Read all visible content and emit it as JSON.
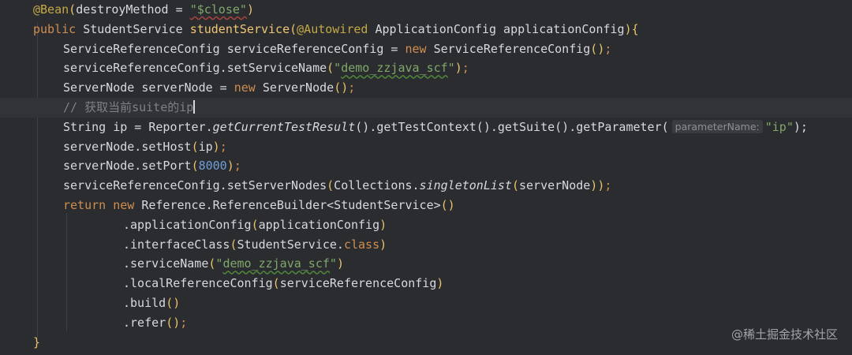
{
  "code": {
    "l1_annotation": "@Bean",
    "l1_paren_open": "(",
    "l1_attr": "destroyMethod",
    "l1_eq": " = ",
    "l1_string": "\"$close\"",
    "l1_paren_close": ")",
    "l2_public": "public",
    "l2_type": " StudentService ",
    "l2_method": "studentService",
    "l2_paren_open": "(",
    "l2_annotation": "@Autowired",
    "l2_params": " ApplicationConfig applicationConfig",
    "l2_paren_close": ")",
    "l2_brace": "{",
    "l3_a": "ServiceReferenceConfig serviceReferenceConfig = ",
    "l3_new": "new",
    "l3_b": " ServiceReferenceConfig",
    "l3_parens": "()",
    "l3_semi": ";",
    "l4_a": "serviceReferenceConfig.setServiceName",
    "l4_po": "(",
    "l4_q1": "\"",
    "l4_str": "demo_zzjava_scf",
    "l4_q2": "\"",
    "l4_pc": ")",
    "l4_semi": ";",
    "l5_a": "ServerNode serverNode = ",
    "l5_new": "new",
    "l5_b": " ServerNode",
    "l5_parens": "()",
    "l5_semi": ";",
    "l6_comment": "// 获取当前suite的ip",
    "l7_a": "String ip = Reporter.",
    "l7_it": "getCurrentTestResult",
    "l7_b": "().getTestContext().getSuite().getParameter(",
    "l7_hint": "parameterName:",
    "l7_str": "\"ip\"",
    "l7_c": ");",
    "l8_a": "serverNode.setHost",
    "l8_po": "(",
    "l8_b": "ip",
    "l8_pc": ")",
    "l8_semi": ";",
    "l9_a": "serverNode.setPort",
    "l9_po": "(",
    "l9_num": "8000",
    "l9_pc": ")",
    "l9_semi": ";",
    "l10_a": "serviceReferenceConfig.setServerNodes",
    "l10_po": "(",
    "l10_b": "Collections.",
    "l10_it": "singletonList",
    "l10_po2": "(",
    "l10_c": "serverNode",
    "l10_pc2": ")",
    "l10_pc": ")",
    "l10_semi": ";",
    "l11_return": "return",
    "l11_new": " new",
    "l11_a": " Reference.ReferenceBuilder<StudentService>",
    "l11_parens": "()",
    "l12_a": ".applicationConfig",
    "l12_po": "(",
    "l12_b": "applicationConfig",
    "l12_pc": ")",
    "l13_a": ".interfaceClass",
    "l13_po": "(",
    "l13_b": "StudentService.",
    "l13_kw": "class",
    "l13_pc": ")",
    "l14_a": ".serviceName",
    "l14_po": "(",
    "l14_q1": "\"",
    "l14_str": "demo_zzjava_scf",
    "l14_q2": "\"",
    "l14_pc": ")",
    "l15_a": ".localReferenceConfig",
    "l15_po": "(",
    "l15_b": "serviceReferenceConfig",
    "l15_pc": ")",
    "l16_a": ".build",
    "l16_parens": "()",
    "l17_a": ".refer",
    "l17_parens": "()",
    "l17_semi": ";",
    "l18_brace": "}"
  },
  "watermark": "@稀土掘金技术社区",
  "colors": {
    "background": "#2b2c30",
    "keyword": "#cf8e4f",
    "annotation": "#c4a845",
    "string": "#7fa86a",
    "number": "#6f9fd8",
    "comment": "#7d8087",
    "method": "#f0c674"
  }
}
